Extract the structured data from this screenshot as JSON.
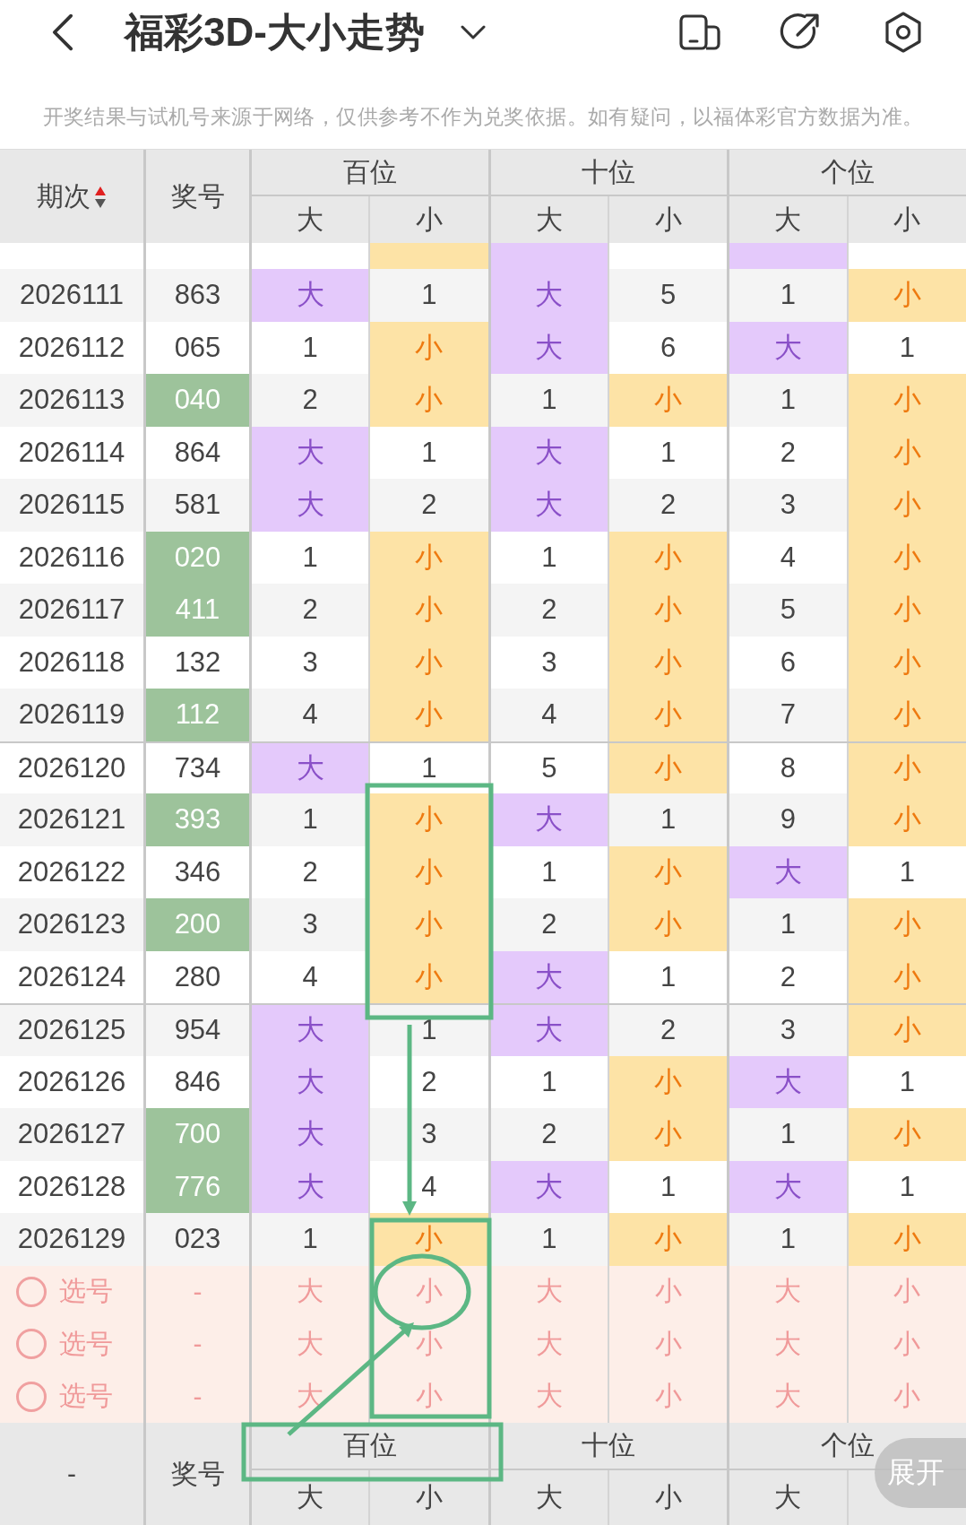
{
  "header": {
    "title": "福彩3D-大小走势"
  },
  "notice": "开奖结果与试机号来源于网络，仅供参考不作为兑奖依据。如有疑问，以福体彩官方数据为准。",
  "table": {
    "period_label": "期次",
    "sorted_ascending": true,
    "number_label": "奖号",
    "groups": [
      {
        "label": "百位",
        "sub": [
          "大",
          "小"
        ]
      },
      {
        "label": "十位",
        "sub": [
          "大",
          "小"
        ]
      },
      {
        "label": "个位",
        "sub": [
          "大",
          "小"
        ]
      }
    ],
    "rows": [
      {
        "partial": true,
        "highlighted": false,
        "cells": [
          {
            "kind": "miss"
          },
          {
            "kind": "small"
          },
          {
            "kind": "big"
          },
          {
            "kind": "miss"
          },
          {
            "kind": "big"
          },
          {
            "kind": "miss"
          }
        ]
      },
      {
        "period": "2026111",
        "number": "863",
        "highlighted": false,
        "cells": [
          {
            "kind": "big",
            "text": "大"
          },
          {
            "kind": "miss",
            "text": "1"
          },
          {
            "kind": "big",
            "text": "大"
          },
          {
            "kind": "miss",
            "text": "5"
          },
          {
            "kind": "miss",
            "text": "1"
          },
          {
            "kind": "small",
            "text": "小"
          }
        ]
      },
      {
        "period": "2026112",
        "number": "065",
        "highlighted": false,
        "cells": [
          {
            "kind": "miss",
            "text": "1"
          },
          {
            "kind": "small",
            "text": "小"
          },
          {
            "kind": "big",
            "text": "大"
          },
          {
            "kind": "miss",
            "text": "6"
          },
          {
            "kind": "big",
            "text": "大"
          },
          {
            "kind": "miss",
            "text": "1"
          }
        ]
      },
      {
        "period": "2026113",
        "number": "040",
        "highlighted": true,
        "cells": [
          {
            "kind": "miss",
            "text": "2"
          },
          {
            "kind": "small",
            "text": "小"
          },
          {
            "kind": "miss",
            "text": "1"
          },
          {
            "kind": "small",
            "text": "小"
          },
          {
            "kind": "miss",
            "text": "1"
          },
          {
            "kind": "small",
            "text": "小"
          }
        ]
      },
      {
        "period": "2026114",
        "number": "864",
        "highlighted": false,
        "cells": [
          {
            "kind": "big",
            "text": "大"
          },
          {
            "kind": "miss",
            "text": "1"
          },
          {
            "kind": "big",
            "text": "大"
          },
          {
            "kind": "miss",
            "text": "1"
          },
          {
            "kind": "miss",
            "text": "2"
          },
          {
            "kind": "small",
            "text": "小"
          }
        ]
      },
      {
        "period": "2026115",
        "number": "581",
        "highlighted": false,
        "cells": [
          {
            "kind": "big",
            "text": "大"
          },
          {
            "kind": "miss",
            "text": "2"
          },
          {
            "kind": "big",
            "text": "大"
          },
          {
            "kind": "miss",
            "text": "2"
          },
          {
            "kind": "miss",
            "text": "3"
          },
          {
            "kind": "small",
            "text": "小"
          }
        ]
      },
      {
        "period": "2026116",
        "number": "020",
        "highlighted": true,
        "cells": [
          {
            "kind": "miss",
            "text": "1"
          },
          {
            "kind": "small",
            "text": "小"
          },
          {
            "kind": "miss",
            "text": "1"
          },
          {
            "kind": "small",
            "text": "小"
          },
          {
            "kind": "miss",
            "text": "4"
          },
          {
            "kind": "small",
            "text": "小"
          }
        ]
      },
      {
        "period": "2026117",
        "number": "411",
        "highlighted": true,
        "cells": [
          {
            "kind": "miss",
            "text": "2"
          },
          {
            "kind": "small",
            "text": "小"
          },
          {
            "kind": "miss",
            "text": "2"
          },
          {
            "kind": "small",
            "text": "小"
          },
          {
            "kind": "miss",
            "text": "5"
          },
          {
            "kind": "small",
            "text": "小"
          }
        ]
      },
      {
        "period": "2026118",
        "number": "132",
        "highlighted": false,
        "cells": [
          {
            "kind": "miss",
            "text": "3"
          },
          {
            "kind": "small",
            "text": "小"
          },
          {
            "kind": "miss",
            "text": "3"
          },
          {
            "kind": "small",
            "text": "小"
          },
          {
            "kind": "miss",
            "text": "6"
          },
          {
            "kind": "small",
            "text": "小"
          }
        ]
      },
      {
        "period": "2026119",
        "number": "112",
        "highlighted": true,
        "cells": [
          {
            "kind": "miss",
            "text": "4"
          },
          {
            "kind": "small",
            "text": "小"
          },
          {
            "kind": "miss",
            "text": "4"
          },
          {
            "kind": "small",
            "text": "小"
          },
          {
            "kind": "miss",
            "text": "7"
          },
          {
            "kind": "small",
            "text": "小"
          }
        ]
      },
      {
        "period": "2026120",
        "number": "734",
        "highlighted": false,
        "cells": [
          {
            "kind": "big",
            "text": "大"
          },
          {
            "kind": "miss",
            "text": "1"
          },
          {
            "kind": "miss",
            "text": "5"
          },
          {
            "kind": "small",
            "text": "小"
          },
          {
            "kind": "miss",
            "text": "8"
          },
          {
            "kind": "small",
            "text": "小"
          }
        ]
      },
      {
        "period": "2026121",
        "number": "393",
        "highlighted": true,
        "cells": [
          {
            "kind": "miss",
            "text": "1"
          },
          {
            "kind": "small",
            "text": "小"
          },
          {
            "kind": "big",
            "text": "大"
          },
          {
            "kind": "miss",
            "text": "1"
          },
          {
            "kind": "miss",
            "text": "9"
          },
          {
            "kind": "small",
            "text": "小"
          }
        ]
      },
      {
        "period": "2026122",
        "number": "346",
        "highlighted": false,
        "cells": [
          {
            "kind": "miss",
            "text": "2"
          },
          {
            "kind": "small",
            "text": "小"
          },
          {
            "kind": "miss",
            "text": "1"
          },
          {
            "kind": "small",
            "text": "小"
          },
          {
            "kind": "big",
            "text": "大"
          },
          {
            "kind": "miss",
            "text": "1"
          }
        ]
      },
      {
        "period": "2026123",
        "number": "200",
        "highlighted": true,
        "cells": [
          {
            "kind": "miss",
            "text": "3"
          },
          {
            "kind": "small",
            "text": "小"
          },
          {
            "kind": "miss",
            "text": "2"
          },
          {
            "kind": "small",
            "text": "小"
          },
          {
            "kind": "miss",
            "text": "1"
          },
          {
            "kind": "small",
            "text": "小"
          }
        ]
      },
      {
        "period": "2026124",
        "number": "280",
        "highlighted": false,
        "cells": [
          {
            "kind": "miss",
            "text": "4"
          },
          {
            "kind": "small",
            "text": "小"
          },
          {
            "kind": "big",
            "text": "大"
          },
          {
            "kind": "miss",
            "text": "1"
          },
          {
            "kind": "miss",
            "text": "2"
          },
          {
            "kind": "small",
            "text": "小"
          }
        ]
      },
      {
        "period": "2026125",
        "number": "954",
        "highlighted": false,
        "cells": [
          {
            "kind": "big",
            "text": "大"
          },
          {
            "kind": "miss",
            "text": "1"
          },
          {
            "kind": "big",
            "text": "大"
          },
          {
            "kind": "miss",
            "text": "2"
          },
          {
            "kind": "miss",
            "text": "3"
          },
          {
            "kind": "small",
            "text": "小"
          }
        ]
      },
      {
        "period": "2026126",
        "number": "846",
        "highlighted": false,
        "cells": [
          {
            "kind": "big",
            "text": "大"
          },
          {
            "kind": "miss",
            "text": "2"
          },
          {
            "kind": "miss",
            "text": "1"
          },
          {
            "kind": "small",
            "text": "小"
          },
          {
            "kind": "big",
            "text": "大"
          },
          {
            "kind": "miss",
            "text": "1"
          }
        ]
      },
      {
        "period": "2026127",
        "number": "700",
        "highlighted": true,
        "cells": [
          {
            "kind": "big",
            "text": "大"
          },
          {
            "kind": "miss",
            "text": "3"
          },
          {
            "kind": "miss",
            "text": "2"
          },
          {
            "kind": "small",
            "text": "小"
          },
          {
            "kind": "miss",
            "text": "1"
          },
          {
            "kind": "small",
            "text": "小"
          }
        ]
      },
      {
        "period": "2026128",
        "number": "776",
        "highlighted": true,
        "cells": [
          {
            "kind": "big",
            "text": "大"
          },
          {
            "kind": "miss",
            "text": "4"
          },
          {
            "kind": "big",
            "text": "大"
          },
          {
            "kind": "miss",
            "text": "1"
          },
          {
            "kind": "big",
            "text": "大"
          },
          {
            "kind": "miss",
            "text": "1"
          }
        ]
      },
      {
        "period": "2026129",
        "number": "023",
        "highlighted": false,
        "cells": [
          {
            "kind": "miss",
            "text": "1"
          },
          {
            "kind": "small",
            "text": "小"
          },
          {
            "kind": "miss",
            "text": "1"
          },
          {
            "kind": "small",
            "text": "小"
          },
          {
            "kind": "miss",
            "text": "1"
          },
          {
            "kind": "small",
            "text": "小"
          }
        ]
      }
    ],
    "picks": [
      {
        "checked": false,
        "label": "选号",
        "number": "-",
        "cells": [
          "大",
          "小",
          "大",
          "小",
          "大",
          "小"
        ]
      },
      {
        "checked": false,
        "label": "选号",
        "number": "-",
        "cells": [
          "大",
          "小",
          "大",
          "小",
          "大",
          "小"
        ]
      },
      {
        "checked": false,
        "label": "选号",
        "number": "-",
        "cells": [
          "大",
          "小",
          "大",
          "小",
          "大",
          "小"
        ]
      }
    ],
    "footer": {
      "period_label": "-",
      "number_label": "奖号",
      "groups": [
        {
          "label": "百位",
          "sub": [
            "大",
            "小"
          ]
        },
        {
          "label": "十位",
          "sub": [
            "大",
            "小"
          ]
        },
        {
          "label": "个位",
          "sub": [
            "大"
          ]
        }
      ]
    }
  },
  "expand_button": "展开"
}
